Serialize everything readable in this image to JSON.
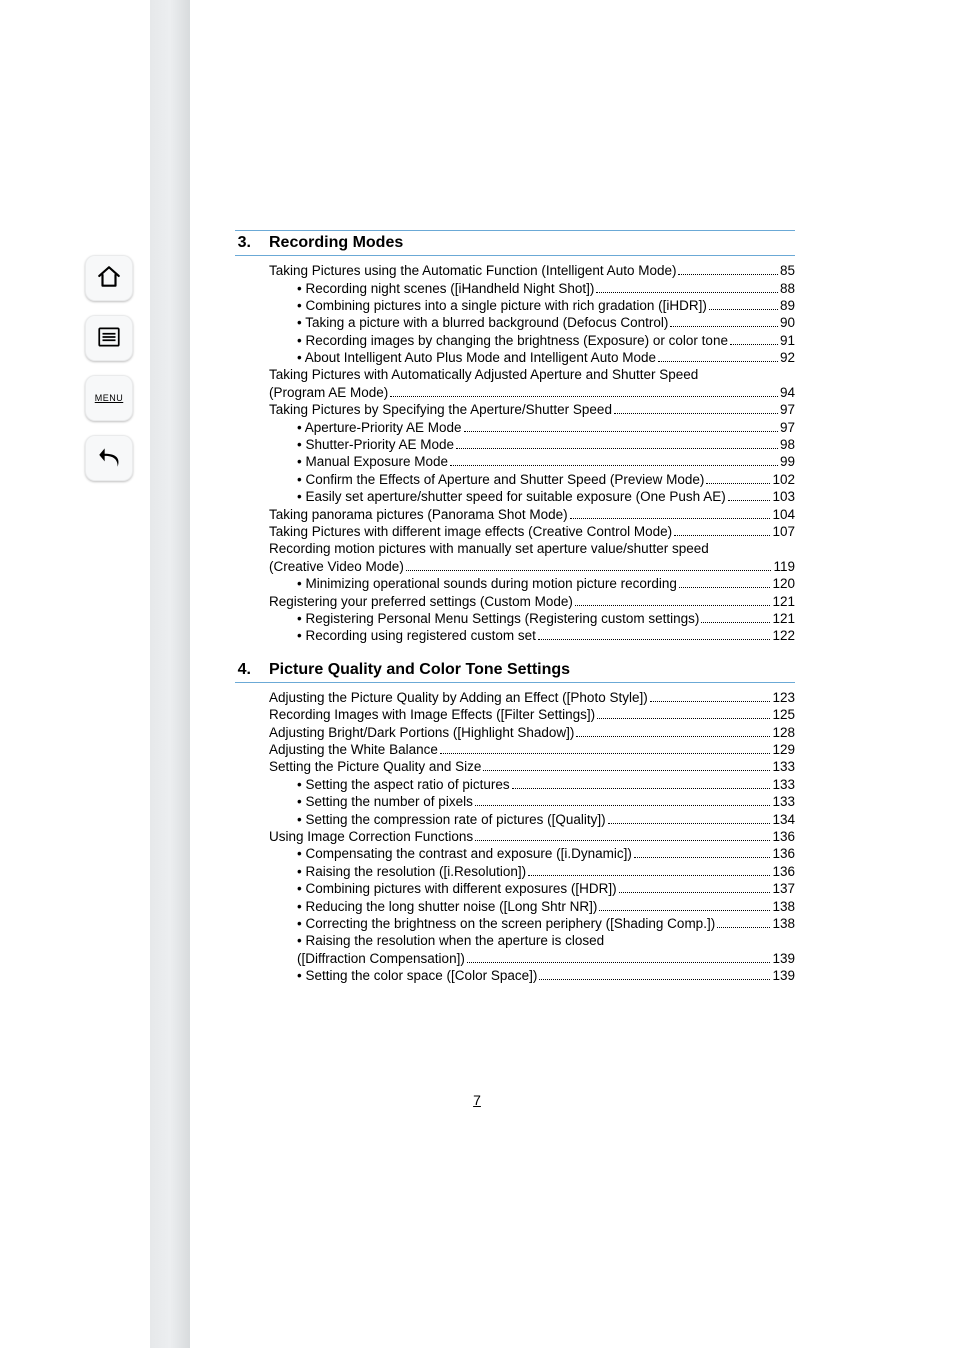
{
  "toolbar": {
    "home_label": "home",
    "toc_label": "toc",
    "menu_label": "MENU",
    "back_label": "back"
  },
  "sections": [
    {
      "number": "3.",
      "title": "Recording Modes",
      "entries": [
        {
          "level": 0,
          "text": "Taking Pictures using the Automatic Function (Intelligent Auto Mode)",
          "page": "85"
        },
        {
          "level": 1,
          "text": "• Recording night scenes ([iHandheld Night Shot])",
          "page": "88"
        },
        {
          "level": 1,
          "text": "• Combining pictures into a single picture with rich gradation ([iHDR])",
          "page": "89"
        },
        {
          "level": 1,
          "text": "• Taking a picture with a blurred background (Defocus Control)",
          "page": "90"
        },
        {
          "level": 1,
          "text": "• Recording images by changing the brightness (Exposure) or color tone",
          "page": "91"
        },
        {
          "level": 1,
          "text": "• About Intelligent Auto Plus Mode and Intelligent Auto Mode",
          "page": "92"
        },
        {
          "level": 0,
          "text": "Taking Pictures with Automatically Adjusted Aperture and Shutter Speed",
          "nopage": true
        },
        {
          "level": 0,
          "cont": true,
          "text": "(Program AE Mode)",
          "page": "94"
        },
        {
          "level": 0,
          "text": "Taking Pictures by Specifying the Aperture/Shutter Speed",
          "page": "97"
        },
        {
          "level": 1,
          "text": "• Aperture-Priority AE Mode",
          "page": "97"
        },
        {
          "level": 1,
          "text": "• Shutter-Priority AE Mode",
          "page": "98"
        },
        {
          "level": 1,
          "text": "• Manual Exposure Mode",
          "page": "99"
        },
        {
          "level": 1,
          "text": "• Confirm the Effects of Aperture and Shutter Speed (Preview Mode)",
          "page": "102"
        },
        {
          "level": 1,
          "text": "• Easily set aperture/shutter speed for suitable exposure (One Push AE)",
          "page": "103"
        },
        {
          "level": 0,
          "text": "Taking panorama pictures (Panorama Shot Mode)",
          "page": "104"
        },
        {
          "level": 0,
          "text": "Taking Pictures with different image effects (Creative Control Mode)",
          "page": "107"
        },
        {
          "level": 0,
          "text": "Recording motion pictures with manually set aperture value/shutter speed",
          "nopage": true
        },
        {
          "level": 0,
          "cont": true,
          "text": "(Creative Video Mode)",
          "page": "119"
        },
        {
          "level": 1,
          "text": "• Minimizing operational sounds during motion picture recording",
          "page": "120"
        },
        {
          "level": 0,
          "text": "Registering your preferred settings (Custom Mode)",
          "page": "121"
        },
        {
          "level": 1,
          "text": "• Registering Personal Menu Settings (Registering custom settings)",
          "page": "121"
        },
        {
          "level": 1,
          "text": "• Recording using registered custom set",
          "page": "122"
        }
      ]
    },
    {
      "number": "4.",
      "title": "Picture Quality and Color Tone Settings",
      "entries": [
        {
          "level": 0,
          "text": "Adjusting the Picture Quality by Adding an Effect ([Photo Style])",
          "page": "123"
        },
        {
          "level": 0,
          "text": "Recording Images with Image Effects ([Filter Settings])",
          "page": "125"
        },
        {
          "level": 0,
          "text": "Adjusting Bright/Dark Portions ([Highlight Shadow])",
          "page": "128"
        },
        {
          "level": 0,
          "text": "Adjusting the White Balance",
          "page": "129"
        },
        {
          "level": 0,
          "text": "Setting the Picture Quality and Size",
          "page": "133"
        },
        {
          "level": 1,
          "text": "• Setting the aspect ratio of pictures",
          "page": "133"
        },
        {
          "level": 1,
          "text": "• Setting the number of pixels",
          "page": "133"
        },
        {
          "level": 1,
          "text": "• Setting the compression rate of pictures ([Quality])",
          "page": "134"
        },
        {
          "level": 0,
          "text": "Using Image Correction Functions",
          "page": "136"
        },
        {
          "level": 1,
          "text": "• Compensating the contrast and exposure ([i.Dynamic])",
          "page": "136"
        },
        {
          "level": 1,
          "text": "• Raising the resolution ([i.Resolution])",
          "page": "136"
        },
        {
          "level": 1,
          "text": "• Combining pictures with different exposures ([HDR])",
          "page": "137"
        },
        {
          "level": 1,
          "text": "• Reducing the long shutter noise ([Long Shtr NR])",
          "page": "138"
        },
        {
          "level": 1,
          "text": "• Correcting the brightness on the screen periphery ([Shading Comp.])",
          "page": "138"
        },
        {
          "level": 1,
          "text": "• Raising the resolution when the aperture is closed",
          "nopage": true
        },
        {
          "level": 1,
          "cont": true,
          "text": "([Diffraction Compensation])",
          "page": "139"
        },
        {
          "level": 1,
          "text": "• Setting the color space ([Color Space])",
          "page": "139"
        }
      ]
    }
  ],
  "page_number": "7"
}
